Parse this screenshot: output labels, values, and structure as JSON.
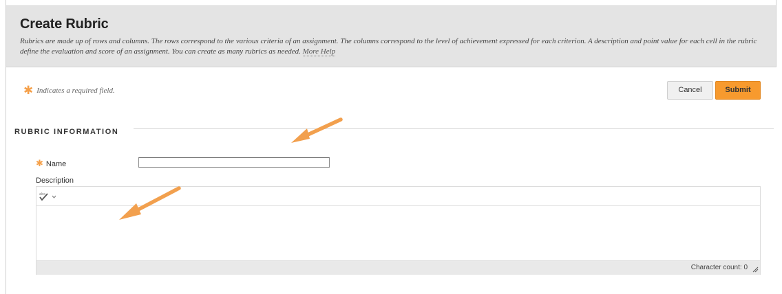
{
  "header": {
    "title": "Create Rubric",
    "description": "Rubrics are made up of rows and columns. The rows correspond to the various criteria of an assignment. The columns correspond to the level of achievement expressed for each criterion. A description and point value for each cell in the rubric define the evaluation and score of an assignment. You can create as many rubrics as needed.",
    "more_help": "More Help"
  },
  "required_note": {
    "star": "✱",
    "text": "Indicates a required field."
  },
  "buttons": {
    "cancel": "Cancel",
    "submit": "Submit"
  },
  "section": {
    "title": "RUBRIC INFORMATION"
  },
  "form": {
    "name_label": "Name",
    "name_star": "✱",
    "name_value": "",
    "description_label": "Description",
    "character_count": "Character count: 0"
  },
  "icons": {
    "spellcheck": "spellcheck-icon",
    "dropdown": "chevron-down-icon",
    "resize": "resize-grip-icon",
    "required": "asterisk-icon",
    "annotation": "arrow-icon"
  },
  "colors": {
    "header_bg": "#e4e4e4",
    "accent_orange": "#f79a2e",
    "required_star": "#f5a04a",
    "annotation_arrow": "#f2a04e"
  }
}
